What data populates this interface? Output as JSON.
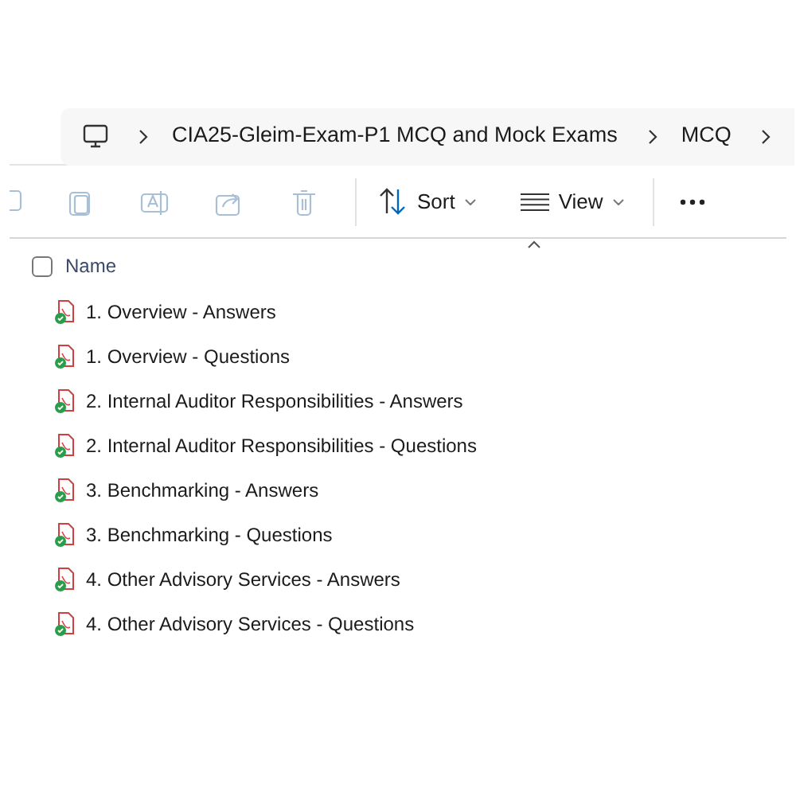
{
  "breadcrumb": [
    "CIA25-Gleim-Exam-P1 MCQ and Mock Exams",
    "MCQ"
  ],
  "toolbar": {
    "actions": [
      {
        "disabled": true
      },
      {
        "disabled": true
      },
      {
        "disabled": true
      },
      {
        "disabled": true
      },
      {
        "disabled": true
      }
    ],
    "sort": "Sort",
    "view": "View"
  },
  "header": {
    "checked": false,
    "label": "Name"
  },
  "files": [
    {
      "name": "1. Overview - Answers"
    },
    {
      "name": "1. Overview - Questions"
    },
    {
      "name": "2. Internal Auditor Responsibilities - Answers"
    },
    {
      "name": "2. Internal Auditor Responsibilities - Questions"
    },
    {
      "name": "3. Benchmarking - Answers"
    },
    {
      "name": "3. Benchmarking - Questions"
    },
    {
      "name": "4. Other Advisory Services - Answers"
    },
    {
      "name": "4. Other Advisory Services - Questions"
    }
  ]
}
